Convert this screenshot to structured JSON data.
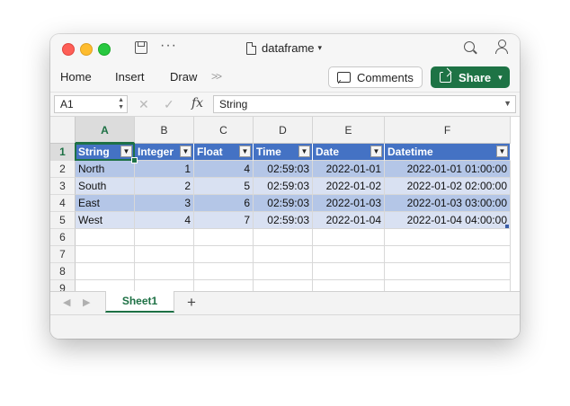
{
  "window": {
    "title": "dataframe"
  },
  "ribbon": {
    "tabs": [
      "Home",
      "Insert",
      "Draw"
    ],
    "more": ">>",
    "comments_label": "Comments",
    "share_label": "Share"
  },
  "formula_bar": {
    "name_box": "A1",
    "fx": "fx",
    "formula": "String"
  },
  "grid": {
    "columns": [
      "A",
      "B",
      "C",
      "D",
      "E",
      "F"
    ],
    "rows": [
      "1",
      "2",
      "3",
      "4",
      "5",
      "6",
      "7",
      "8",
      "9"
    ],
    "headers": [
      "String",
      "Integer",
      "Float",
      "Time",
      "Date",
      "Datetime"
    ],
    "data": [
      [
        "North",
        "1",
        "4",
        "02:59:03",
        "2022-01-01",
        "2022-01-01 01:00:00"
      ],
      [
        "South",
        "2",
        "5",
        "02:59:03",
        "2022-01-02",
        "2022-01-02 02:00:00"
      ],
      [
        "East",
        "3",
        "6",
        "02:59:03",
        "2022-01-03",
        "2022-01-03 03:00:00"
      ],
      [
        "West",
        "4",
        "7",
        "02:59:03",
        "2022-01-04",
        "2022-01-04 04:00:00"
      ]
    ],
    "active_cell": "A1"
  },
  "sheets": {
    "tabs": [
      "Sheet1"
    ],
    "active": "Sheet1",
    "add_label": "+"
  },
  "colors": {
    "table_header": "#4472c4",
    "band_dark": "#b4c6e7",
    "band_light": "#d9e1f2",
    "accent_green": "#1e7345"
  }
}
